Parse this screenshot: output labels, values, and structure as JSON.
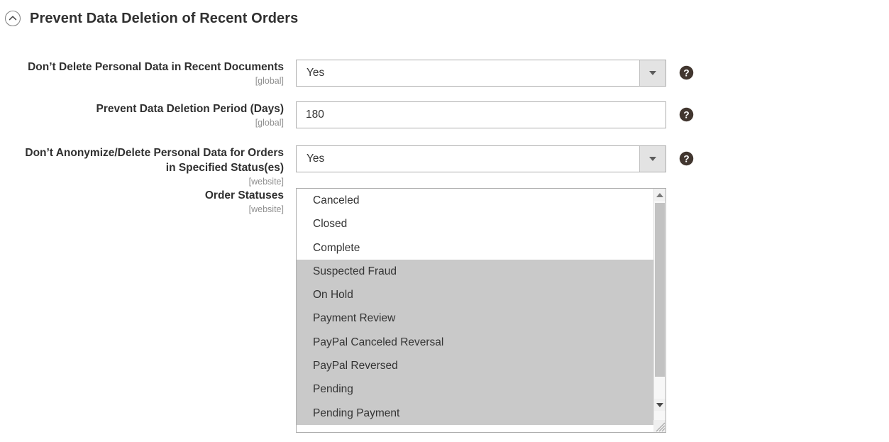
{
  "section": {
    "title": "Prevent Data Deletion of Recent Orders",
    "collapse_icon": "chevron-up-circle-icon"
  },
  "fields": [
    {
      "label": "Don’t Delete Personal Data in Recent Documents",
      "scope": "[global]",
      "type": "select",
      "value": "Yes",
      "help_icon": "question-mark-icon"
    },
    {
      "label": "Prevent Data Deletion Period (Days)",
      "scope": "[global]",
      "type": "text",
      "value": "180",
      "placeholder": "",
      "help_icon": "question-mark-icon"
    },
    {
      "label": "Don’t Anonymize/Delete Personal Data for Orders in Specified Status(es)",
      "label_line1": "Don’t Anonymize/Delete Personal Data for Orders",
      "label_line2": "in Specified Status(es)",
      "scope": "[website]",
      "type": "select",
      "value": "Yes",
      "help_icon": "question-mark-icon"
    },
    {
      "label": "Order Statuses",
      "scope": "[website]",
      "type": "multiselect"
    }
  ],
  "order_statuses": {
    "options": [
      {
        "label": "Canceled",
        "selected": false
      },
      {
        "label": "Closed",
        "selected": false
      },
      {
        "label": "Complete",
        "selected": false
      },
      {
        "label": "Suspected Fraud",
        "selected": true
      },
      {
        "label": "On Hold",
        "selected": true
      },
      {
        "label": "Payment Review",
        "selected": true
      },
      {
        "label": "PayPal Canceled Reversal",
        "selected": true
      },
      {
        "label": "PayPal Reversed",
        "selected": true
      },
      {
        "label": "Pending",
        "selected": true
      },
      {
        "label": "Pending Payment",
        "selected": true
      }
    ],
    "scrollbar": {
      "up_icon": "scroll-up-arrow-icon",
      "down_icon": "scroll-down-arrow-icon",
      "resize_icon": "resize-grip-icon"
    }
  },
  "colors": {
    "text": "#333333",
    "label": "#303030",
    "scope": "#8f8f8f",
    "border": "#adadad",
    "selected_row": "#c9c9c9",
    "help_icon": "#41362f",
    "select_button": "#e3e3e3"
  }
}
